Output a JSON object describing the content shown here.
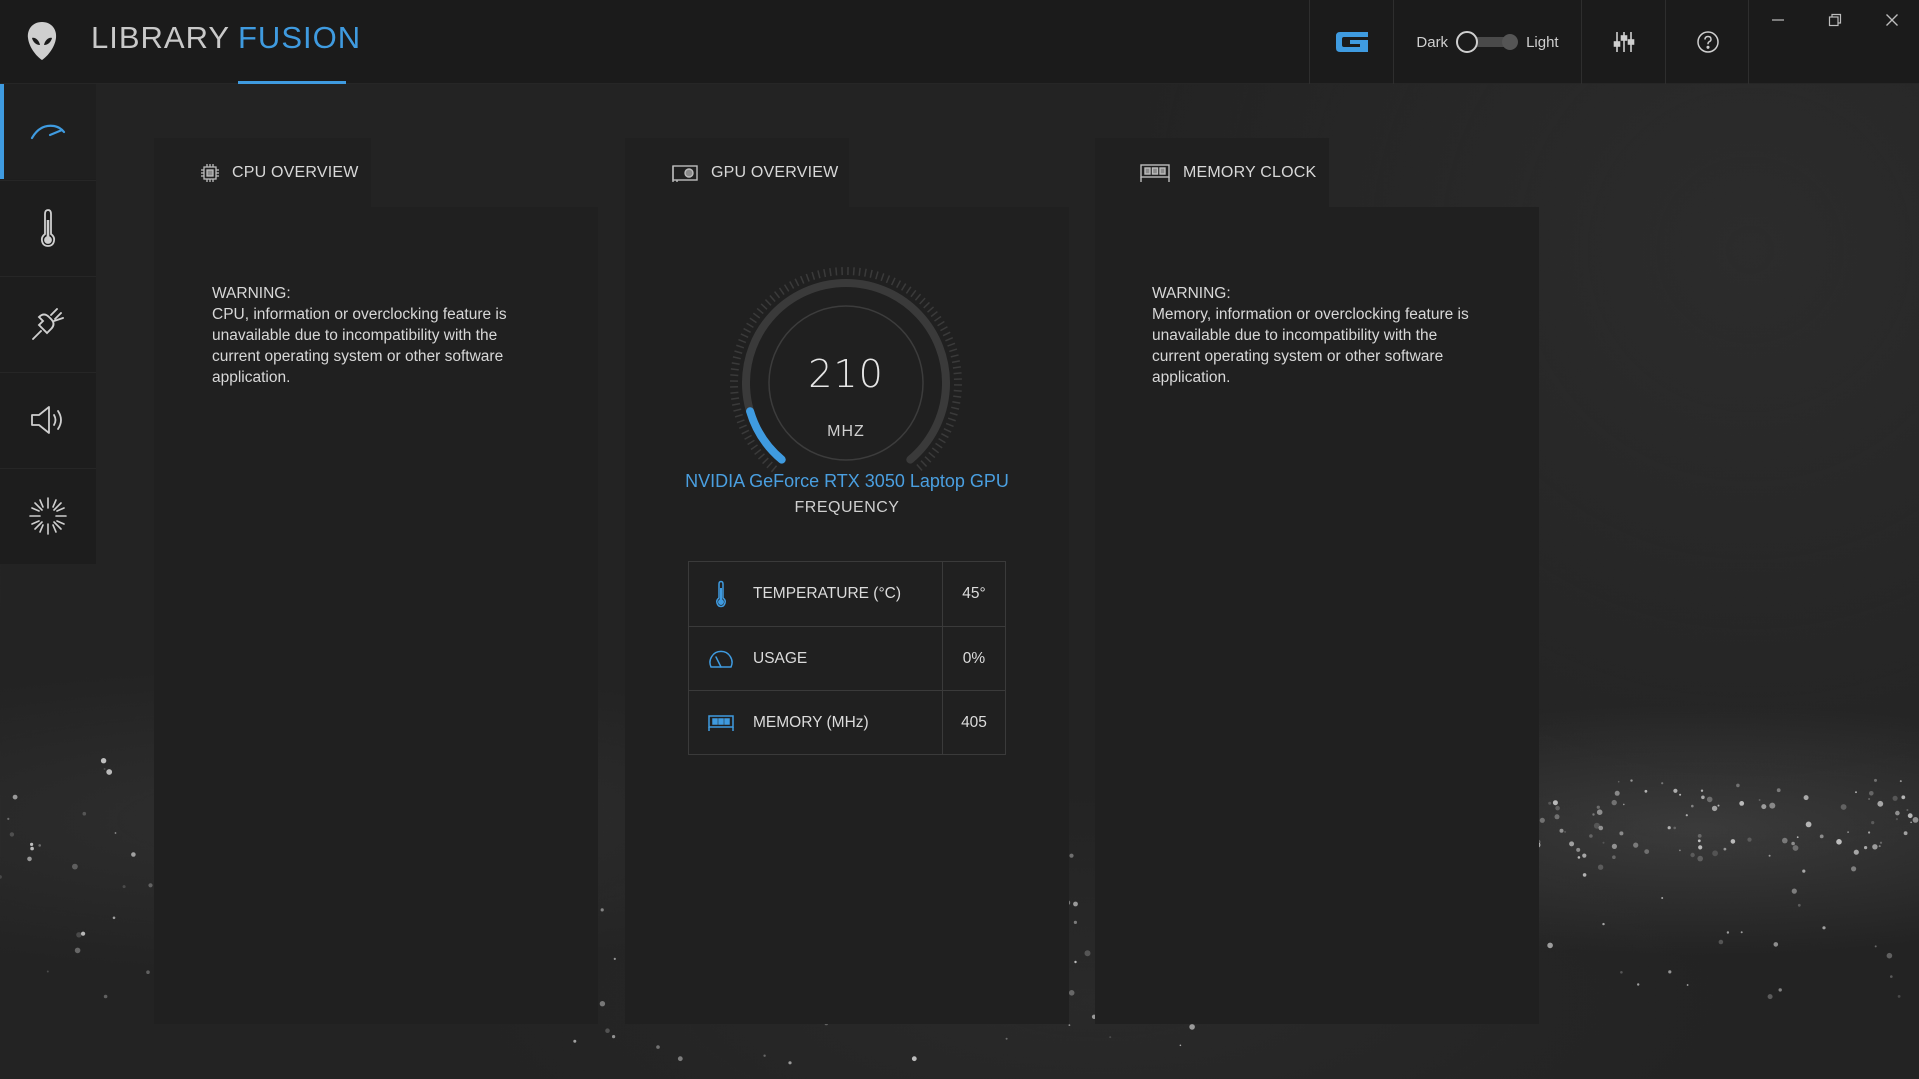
{
  "header": {
    "nav": {
      "library": "LIBRARY",
      "fusion": "FUSION"
    },
    "theme": {
      "dark_label": "Dark",
      "light_label": "Light"
    }
  },
  "panels": {
    "cpu": {
      "tab_label": "CPU OVERVIEW",
      "warning_title": "WARNING:",
      "warning_text": "CPU, information or overclocking feature is unavailable due to incompatibility with the current operating system or other software application."
    },
    "gpu": {
      "tab_label": "GPU OVERVIEW",
      "frequency_value": "210",
      "frequency_unit": "MHZ",
      "frequency_fraction": 0.12,
      "gpu_name": "NVIDIA GeForce RTX 3050 Laptop GPU",
      "frequency_label": "FREQUENCY",
      "stats": [
        {
          "icon": "thermometer-icon",
          "label": "TEMPERATURE (°C)",
          "value": "45°"
        },
        {
          "icon": "usage-gauge-icon",
          "label": "USAGE",
          "value": "0%"
        },
        {
          "icon": "memory-chip-icon",
          "label": "MEMORY (MHz)",
          "value": "405"
        }
      ]
    },
    "memory": {
      "tab_label": "MEMORY CLOCK",
      "warning_title": "WARNING:",
      "warning_text": "Memory, information or overclocking feature is unavailable due to incompatibility with the current operating system or other software application."
    }
  },
  "sidebar": {
    "items": [
      {
        "icon": "speedometer-icon",
        "active": true
      },
      {
        "icon": "thermometer-icon",
        "active": false
      },
      {
        "icon": "power-plug-icon",
        "active": false
      },
      {
        "icon": "speaker-icon",
        "active": false
      },
      {
        "icon": "lighting-burst-icon",
        "active": false
      }
    ]
  },
  "colors": {
    "accent": "#3f9be0",
    "background": "#232323",
    "panel": "#202020",
    "topbar": "#1b1b1b"
  }
}
